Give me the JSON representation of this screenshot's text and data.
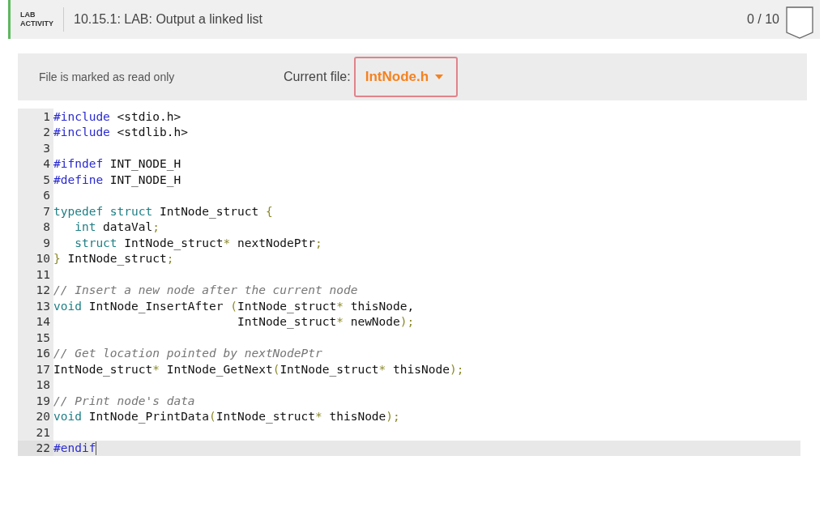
{
  "header": {
    "label_lines": [
      "LAB",
      "ACTIVITY"
    ],
    "title": "10.15.1: LAB: Output a linked list",
    "score": "0 / 10"
  },
  "file_bar": {
    "read_only_note": "File is marked as read only",
    "current_file_label": "Current file:",
    "current_file": "IntNode.h"
  },
  "code_lines": [
    {
      "number": "1",
      "active": false,
      "tokens": [
        {
          "kind": "pre",
          "text": "#include"
        },
        {
          "kind": "plain",
          "text": " <stdio.h>"
        }
      ]
    },
    {
      "number": "2",
      "active": false,
      "tokens": [
        {
          "kind": "pre",
          "text": "#include"
        },
        {
          "kind": "plain",
          "text": " <stdlib.h>"
        }
      ]
    },
    {
      "number": "3",
      "active": false
    },
    {
      "number": "4",
      "active": false,
      "tokens": [
        {
          "kind": "pre",
          "text": "#ifndef"
        },
        {
          "kind": "plain",
          "text": " INT_NODE_H"
        }
      ]
    },
    {
      "number": "5",
      "active": false,
      "tokens": [
        {
          "kind": "pre",
          "text": "#define"
        },
        {
          "kind": "plain",
          "text": " INT_NODE_H"
        }
      ]
    },
    {
      "number": "6",
      "active": false
    },
    {
      "number": "7",
      "active": false,
      "tokens": [
        {
          "kind": "kw",
          "text": "typedef"
        },
        {
          "kind": "kw",
          "text": " struct"
        },
        {
          "kind": "plain",
          "text": " IntNode_struct "
        },
        {
          "kind": "pu",
          "text": "{"
        }
      ]
    },
    {
      "number": "8",
      "active": false,
      "tokens": [
        {
          "kind": "kw",
          "text": "   int"
        },
        {
          "kind": "plain",
          "text": " dataVal"
        },
        {
          "kind": "pu",
          "text": ";"
        }
      ]
    },
    {
      "number": "9",
      "active": false,
      "tokens": [
        {
          "kind": "kw",
          "text": "   struct"
        },
        {
          "kind": "plain",
          "text": " IntNode_struct"
        },
        {
          "kind": "pu",
          "text": "*"
        },
        {
          "kind": "plain",
          "text": " nextNodePtr"
        },
        {
          "kind": "pu",
          "text": ";"
        }
      ]
    },
    {
      "number": "10",
      "active": false,
      "tokens": [
        {
          "kind": "pu",
          "text": "}"
        },
        {
          "kind": "plain",
          "text": " IntNode_struct"
        },
        {
          "kind": "pu",
          "text": ";"
        }
      ]
    },
    {
      "number": "11",
      "active": false
    },
    {
      "number": "12",
      "active": false,
      "tokens": [
        {
          "kind": "cm",
          "text": "// Insert a new node after the current node"
        }
      ]
    },
    {
      "number": "13",
      "active": false,
      "tokens": [
        {
          "kind": "kw",
          "text": "void"
        },
        {
          "kind": "plain",
          "text": " IntNode_InsertAfter "
        },
        {
          "kind": "pu",
          "text": "("
        },
        {
          "kind": "plain",
          "text": "IntNode_struct"
        },
        {
          "kind": "pu",
          "text": "*"
        },
        {
          "kind": "plain",
          "text": " thisNode,"
        }
      ]
    },
    {
      "number": "14",
      "active": false,
      "tokens": [
        {
          "kind": "plain",
          "text": "                          IntNode_struct"
        },
        {
          "kind": "pu",
          "text": "*"
        },
        {
          "kind": "plain",
          "text": " newNode"
        },
        {
          "kind": "pu",
          "text": ");"
        }
      ]
    },
    {
      "number": "15",
      "active": false
    },
    {
      "number": "16",
      "active": false,
      "tokens": [
        {
          "kind": "cm",
          "text": "// Get location pointed by nextNodePtr"
        }
      ]
    },
    {
      "number": "17",
      "active": false,
      "tokens": [
        {
          "kind": "plain",
          "text": "IntNode_struct"
        },
        {
          "kind": "pu",
          "text": "*"
        },
        {
          "kind": "plain",
          "text": " IntNode_GetNext"
        },
        {
          "kind": "pu",
          "text": "("
        },
        {
          "kind": "plain",
          "text": "IntNode_struct"
        },
        {
          "kind": "pu",
          "text": "*"
        },
        {
          "kind": "plain",
          "text": " thisNode"
        },
        {
          "kind": "pu",
          "text": ");"
        }
      ]
    },
    {
      "number": "18",
      "active": false
    },
    {
      "number": "19",
      "active": false,
      "tokens": [
        {
          "kind": "cm",
          "text": "// Print node's data"
        }
      ]
    },
    {
      "number": "20",
      "active": false,
      "tokens": [
        {
          "kind": "kw",
          "text": "void"
        },
        {
          "kind": "plain",
          "text": " IntNode_PrintData"
        },
        {
          "kind": "pu",
          "text": "("
        },
        {
          "kind": "plain",
          "text": "IntNode_struct"
        },
        {
          "kind": "pu",
          "text": "*"
        },
        {
          "kind": "plain",
          "text": " thisNode"
        },
        {
          "kind": "pu",
          "text": ");"
        }
      ]
    },
    {
      "number": "21",
      "active": false
    },
    {
      "number": "22",
      "active": true,
      "tokens": [
        {
          "kind": "pre",
          "text": "#endif"
        }
      ]
    }
  ]
}
